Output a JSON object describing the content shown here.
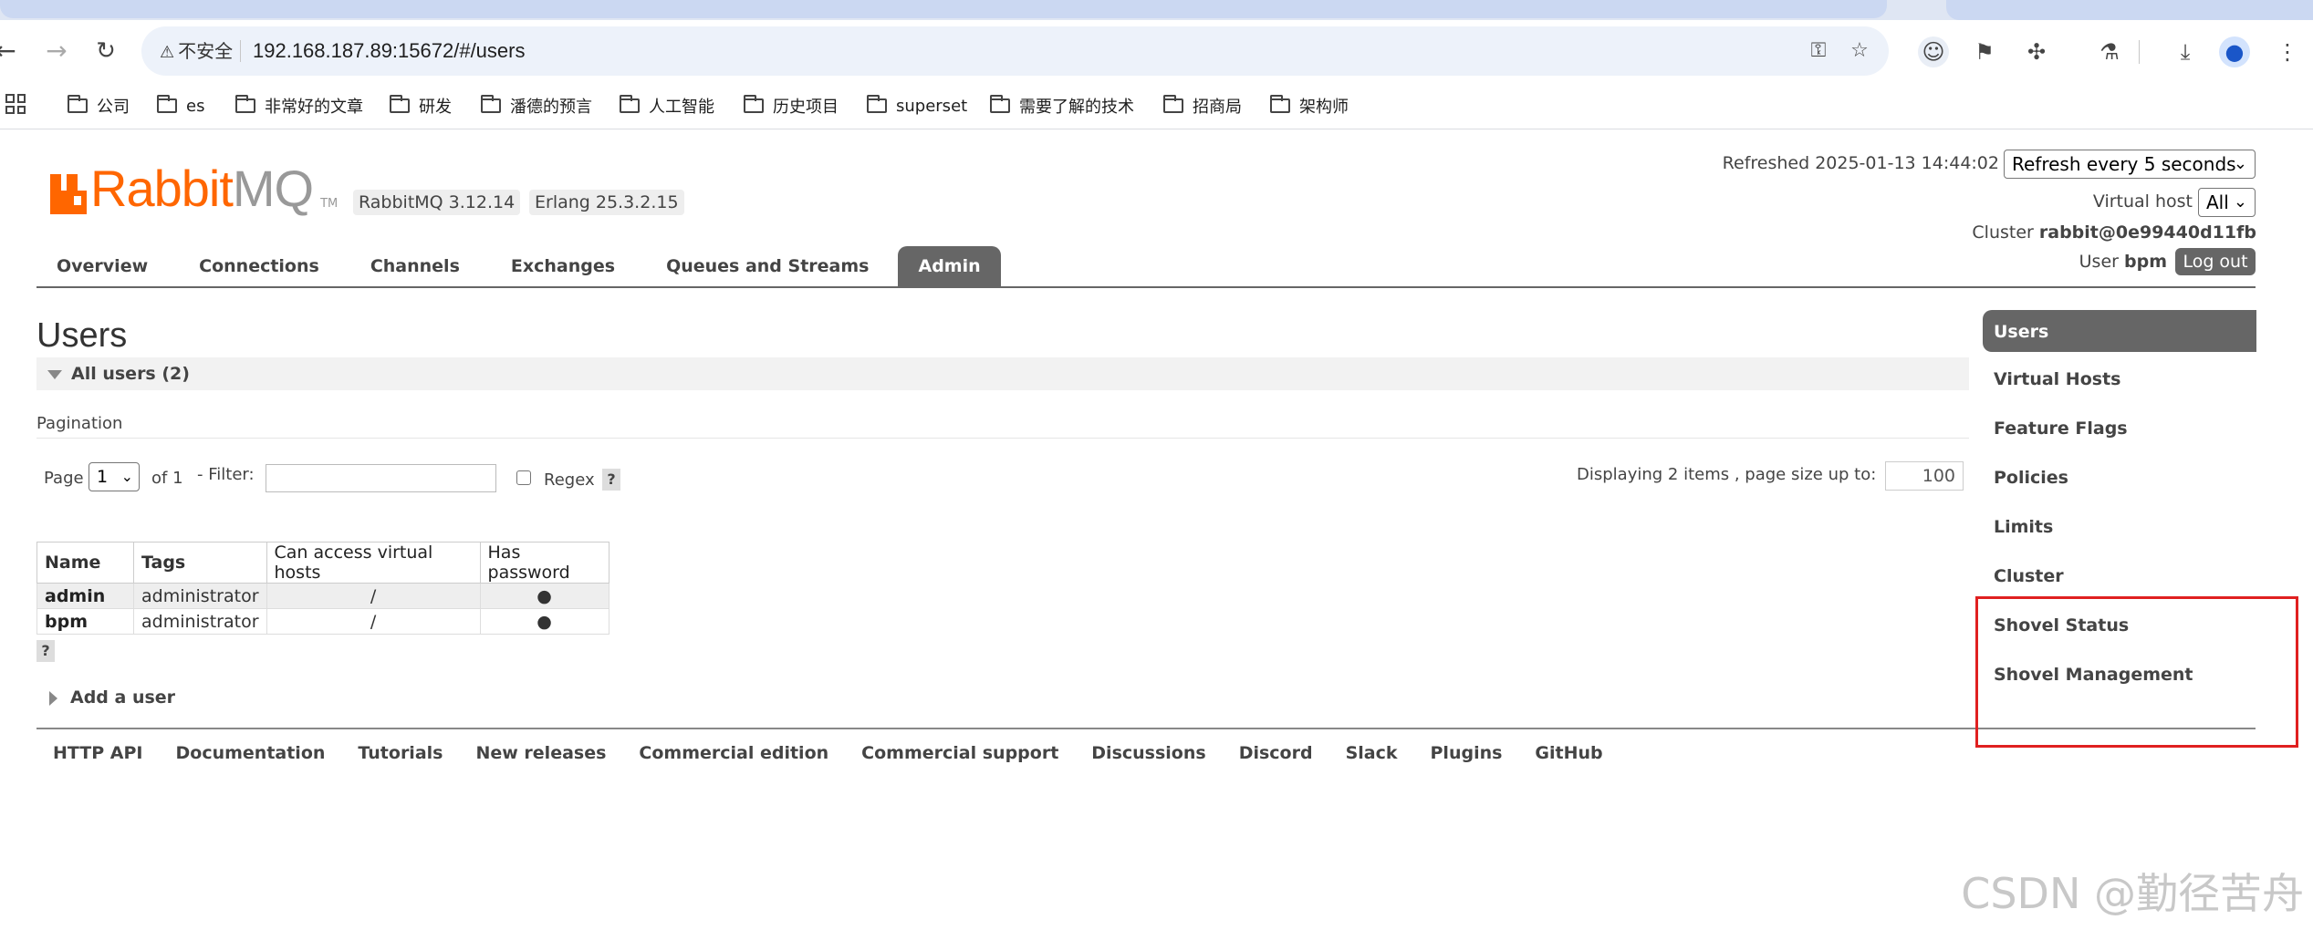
{
  "browser": {
    "security_label": "不安全",
    "url": "192.168.187.89:15672/#/users",
    "bookmarks": [
      "公司",
      "es",
      "非常好的文章",
      "研发",
      "潘德的预言",
      "人工智能",
      "历史项目",
      "superset",
      "需要了解的技术",
      "招商局",
      "架构师"
    ]
  },
  "header": {
    "logo_rabbit": "Rabbit",
    "logo_mq": "MQ",
    "logo_tm": "TM",
    "rabbitmq_version": "RabbitMQ 3.12.14",
    "erlang_version": "Erlang 25.3.2.15",
    "refreshed_label": "Refreshed 2025-01-13 14:44:02",
    "refresh_option": "Refresh every 5 seconds",
    "virtual_host_label": "Virtual host",
    "virtual_host_value": "All",
    "cluster_label": "Cluster",
    "cluster_name": "rabbit@0e99440d11fb",
    "user_label": "User",
    "user_name": "bpm",
    "logout_label": "Log out"
  },
  "tabs": [
    "Overview",
    "Connections",
    "Channels",
    "Exchanges",
    "Queues and Streams",
    "Admin"
  ],
  "main": {
    "title": "Users",
    "section_label": "All users (2)",
    "pagination_label": "Pagination",
    "page_label": "Page",
    "page_value": "1",
    "of_label": "of 1",
    "filter_label": "- Filter:",
    "regex_label": "Regex",
    "help": "?",
    "displaying_label": "Displaying 2 items , page size up to:",
    "page_size": "100",
    "add_user_label": "Add a user"
  },
  "table": {
    "headers": [
      "Name",
      "Tags",
      "Can access virtual hosts",
      "Has password"
    ],
    "rows": [
      {
        "name": "admin",
        "tags": "administrator",
        "vhosts": "/",
        "has_password": "●"
      },
      {
        "name": "bpm",
        "tags": "administrator",
        "vhosts": "/",
        "has_password": "●"
      }
    ]
  },
  "sidebar": [
    "Users",
    "Virtual Hosts",
    "Feature Flags",
    "Policies",
    "Limits",
    "Cluster",
    "Shovel Status",
    "Shovel Management"
  ],
  "footer": [
    "HTTP API",
    "Documentation",
    "Tutorials",
    "New releases",
    "Commercial edition",
    "Commercial support",
    "Discussions",
    "Discord",
    "Slack",
    "Plugins",
    "GitHub"
  ],
  "watermark": "CSDN @勤径苦舟",
  "colors": {
    "brand_orange": "#ff6600",
    "tab_active": "#666666",
    "highlight_box": "#e02020"
  }
}
